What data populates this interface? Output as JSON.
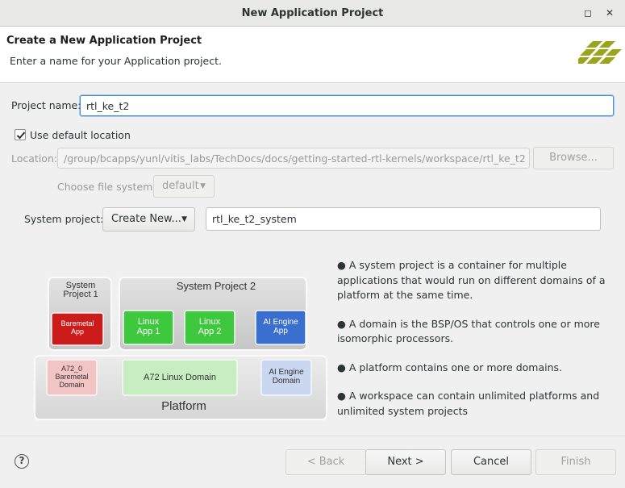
{
  "window": {
    "title": "New Application Project"
  },
  "header": {
    "title": "Create a New Application Project",
    "subtitle": "Enter a name for your Application project."
  },
  "form": {
    "project_name_label": "Project name:",
    "project_name_value": "rtl_ke_t2",
    "use_default_label": "Use default location",
    "use_default_checked": true,
    "location_label": "Location:",
    "location_value": "/group/bcapps/yunl/vitis_labs/TechDocs/docs/getting-started-rtl-kernels/workspace/rtl_ke_t2",
    "browse_label": "Browse...",
    "file_system_label": "Choose file system:",
    "file_system_value": "default",
    "system_project_label": "System project:",
    "system_project_select": "Create New...",
    "system_project_name": "rtl_ke_t2_system"
  },
  "diagram": {
    "system_project_1": "System\nProject 1",
    "system_project_2": "System Project 2",
    "baremetal_app": "Baremetal\nApp",
    "linux_app_1": "Linux\nApp 1",
    "linux_app_2": "Linux\nApp 2",
    "ai_engine_app": "AI Engine\nApp",
    "a72_baremetal_domain": "A72_0\nBaremetal\nDomain",
    "a72_linux_domain": "A72 Linux Domain",
    "ai_engine_domain": "AI Engine\nDomain",
    "platform": "Platform"
  },
  "bullets": [
    "● A system project is a container for multiple applications that would run on different domains of a platform at the same time.",
    "● A domain is the BSP/OS that controls one or more isomorphic processors.",
    "● A platform contains one or more domains.",
    "● A workspace can contain unlimited platforms and unlimited system projects"
  ],
  "buttons": {
    "back": "< Back",
    "next": "Next >",
    "cancel": "Cancel",
    "finish": "Finish"
  },
  "colors": {
    "red_box": "#cc1b1b",
    "green_box": "#3ec83e",
    "blue_box": "#3a6fd0",
    "focus": "#4a90d9",
    "logo": "#9aa51a"
  }
}
